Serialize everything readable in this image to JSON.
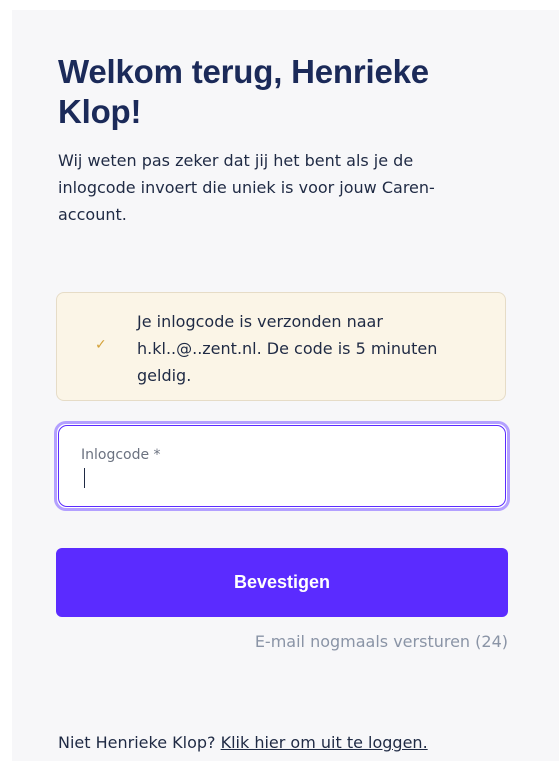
{
  "header": {
    "title": "Welkom terug, Henrieke Klop!",
    "subtitle": "Wij weten pas zeker dat jij het bent als je de inlogcode invoert die uniek is voor jouw Caren-account."
  },
  "notice": {
    "icon": "checkmark-icon",
    "message": "Je inlogcode is verzonden naar h.kl..@..zent.nl. De code is 5 minuten geldig."
  },
  "form": {
    "code_label": "Inlogcode *",
    "code_value": "",
    "confirm_label": "Bevestigen",
    "resend_label": "E-mail nogmaals versturen (24)"
  },
  "footer": {
    "prefix": "Niet Henrieke Klop?",
    "logout_link": "Klik hier om uit te loggen."
  },
  "colors": {
    "accent": "#5b2bff",
    "title": "#1b2a59",
    "notice_bg": "#fbf5e7",
    "check": "#d4a23a",
    "muted": "#8a94a6"
  }
}
